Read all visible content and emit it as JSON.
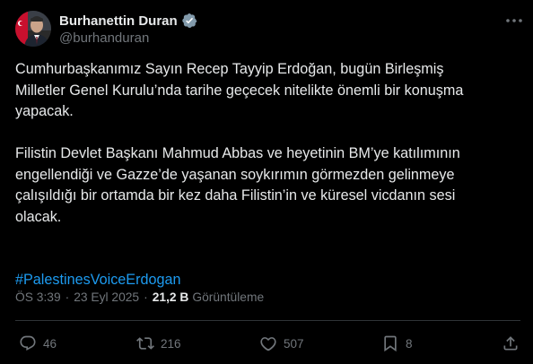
{
  "author": {
    "display_name": "Burhanettin Duran",
    "handle": "@burhanduran",
    "verified": true
  },
  "tweet": {
    "paragraphs": [
      "Cumhurbaşkanımız Sayın Recep Tayyip Erdoğan, bugün Birleşmiş\nMilletler Genel Kurulu’nda tarihe geçecek nitelikte önemli bir konuşma\nyapacak.",
      "Filistin Devlet Başkanı Mahmud Abbas ve heyetinin BM’ye katılımının\nengellendiği ve Gazze’de yaşanan soykırımın görmezden gelinmeye\nçalışıldığı bir ortamda bir kez daha Filistin’in ve küresel vicdanın sesi\nolacak."
    ],
    "hashtag": "#PalestinesVoiceErdogan"
  },
  "meta": {
    "time": "ÖS 3:39",
    "separator": "·",
    "date": "23 Eyl 2025",
    "views_count": "21,2 B",
    "views_label": "Görüntüleme"
  },
  "actions": {
    "replies": "46",
    "reposts": "216",
    "likes": "507",
    "bookmarks": "8"
  },
  "colors": {
    "background": "#000000",
    "text": "#e7e9ea",
    "secondary": "#71767b",
    "link": "#1d9bf0",
    "verified": "#829aab",
    "divider": "#2f3336"
  },
  "icons": {
    "verified": "verified-badge-icon",
    "more": "more-dots-icon",
    "reply": "reply-icon",
    "repost": "repost-icon",
    "like": "heart-icon",
    "bookmark": "bookmark-icon",
    "share": "share-icon"
  }
}
